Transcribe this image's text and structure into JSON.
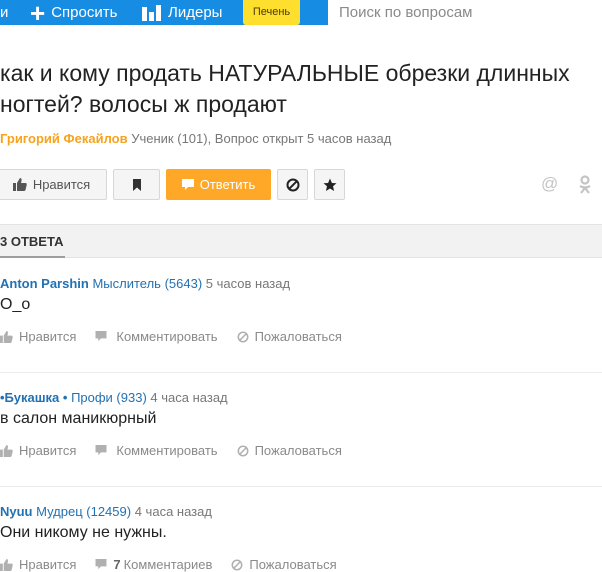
{
  "topbar": {
    "cut_label": "и",
    "ask_label": "Спросить",
    "leaders_label": "Лидеры",
    "badge": "Печень",
    "search_placeholder": "Поиск по вопросам"
  },
  "question": {
    "title": "как и кому продать НАТУРАЛЬНЫЕ обрезки длинных ногтей? волосы ж продают",
    "author": "Григорий Фекайлов",
    "meta": "Ученик (101), Вопрос открыт 5 часов назад",
    "actions": {
      "like_label": "Нравится",
      "answer_label": "Ответить"
    }
  },
  "answers_header": "3 ОТВЕТА",
  "answers": [
    {
      "author": "Anton Parshin",
      "rank": "Мыслитель (5643)",
      "time": "5 часов назад",
      "text": "О_о",
      "like": "Нравится",
      "comment": "Комментировать",
      "comment_count": "",
      "report": "Пожаловаться"
    },
    {
      "author": "•Букашка •",
      "rank": "Профи (933)",
      "time": "4 часа назад",
      "text": "в салон маникюрный",
      "like": "Нравится",
      "comment": "Комментировать",
      "comment_count": "",
      "report": "Пожаловаться"
    },
    {
      "author": "Nyuu",
      "rank": "Мудрец (12459)",
      "time": "4 часа назад",
      "text": "Они никому не нужны.",
      "like": "Нравится",
      "comment": "Комментариев",
      "comment_count": "7",
      "report": "Пожаловаться"
    }
  ],
  "colors": {
    "topbar": "#168de2",
    "badge": "#ffdf2d",
    "answer_button": "#ffa726",
    "author_link": "#f7a31e",
    "user_link": "#2271b3"
  },
  "icons": [
    "plus-icon",
    "leaders-icon",
    "thumb-up-icon",
    "flag-icon",
    "comment-icon",
    "block-icon",
    "star-icon",
    "at-icon",
    "odnoklassniki-icon"
  ]
}
